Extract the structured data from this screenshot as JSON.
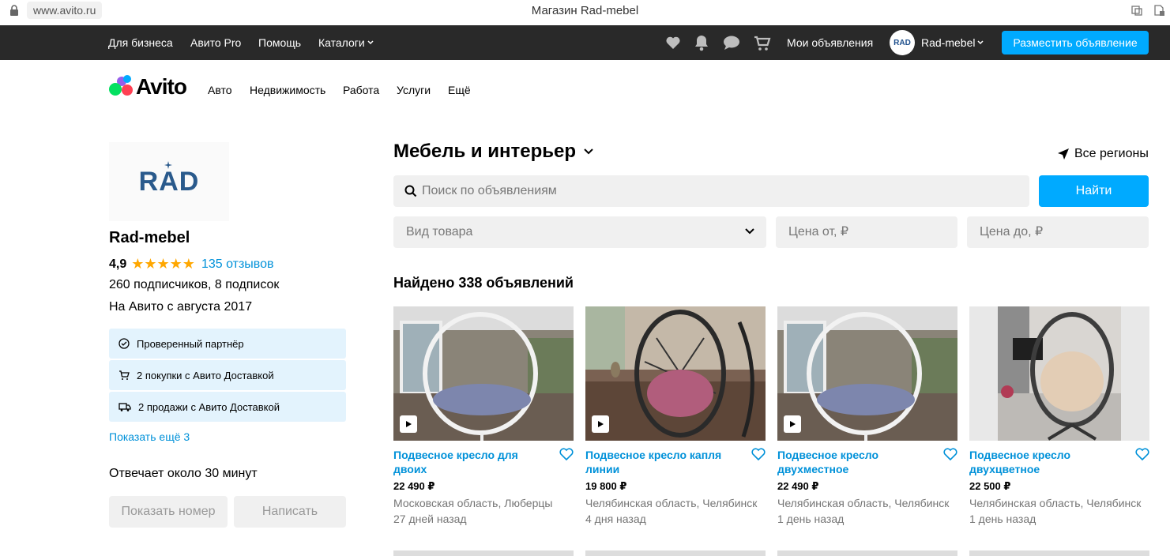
{
  "browser": {
    "url": "www.avito.ru",
    "tab_title": "Магазин Rad-mebel"
  },
  "topbar": {
    "links": [
      "Для бизнеса",
      "Авито Pro",
      "Помощь",
      "Каталоги"
    ],
    "my_ads": "Мои объявления",
    "user_name": "Rad-mebel",
    "avatar_text": "RAD",
    "post_button": "Разместить объявление"
  },
  "logo": {
    "word": "Avito"
  },
  "categories": [
    "Авто",
    "Недвижимость",
    "Работа",
    "Услуги",
    "Ещё"
  ],
  "profile": {
    "logo_text": "RAD",
    "name": "Rad-mebel",
    "rating": "4,9",
    "stars": "★★★★★",
    "reviews": "135 отзывов",
    "subscribers": "260 подписчиков, 8 подписок",
    "since": "На Авито с августа 2017",
    "badges": [
      "Проверенный партнёр",
      "2 покупки с Авито Доставкой",
      "2 продажи с Авито Доставкой"
    ],
    "show_more": "Показать ещё 3",
    "responds": "Отвечает около 30 минут",
    "show_phone": "Показать номер",
    "write": "Написать"
  },
  "main": {
    "category_title": "Мебель и интерьер",
    "regions": "Все регионы",
    "search_placeholder": "Поиск по объявлениям",
    "find_button": "Найти",
    "filter_type": "Вид товара",
    "price_from": "Цена от, ₽",
    "price_to": "Цена до, ₽",
    "found": "Найдено 338 объявлений"
  },
  "listings": [
    {
      "title": "Подвесное кресло для двоих",
      "price": "22 490 ₽",
      "location": "Московская область, Люберцы",
      "date": "27 дней назад",
      "has_video": true
    },
    {
      "title": "Подвесное кресло капля линии",
      "price": "19 800 ₽",
      "location": "Челябинская область, Челябинск",
      "date": "4 дня назад",
      "has_video": true
    },
    {
      "title": "Подвесное кресло двухместное",
      "price": "22 490 ₽",
      "location": "Челябинская область, Челябинск",
      "date": "1 день назад",
      "has_video": true
    },
    {
      "title": "Подвесное кресло двухцветное",
      "price": "22 500 ₽",
      "location": "Челябинская область, Челябинск",
      "date": "1 день назад",
      "has_video": false
    }
  ],
  "colors": {
    "accent": "#00aaff",
    "link": "#0091d9",
    "topbar": "#292929",
    "badge_bg": "#e3f3fd",
    "star": "#ffa700"
  }
}
